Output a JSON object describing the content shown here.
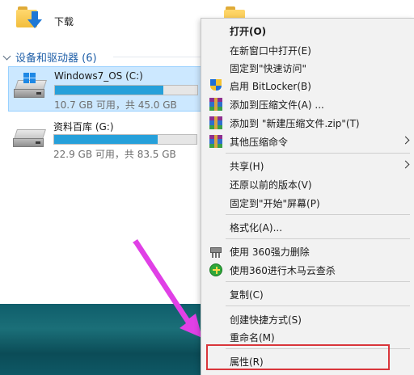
{
  "explorer": {
    "quick_item_label": "下载",
    "section_title": "设备和驱动器 (6)",
    "drives": [
      {
        "name": "Windows7_OS (C:)",
        "size_text": "10.7 GB 可用，共 45.0 GB",
        "used_fraction": 0.762
      },
      {
        "name": "资料百库 (G:)",
        "size_text": "22.9 GB 可用，共 83.5 GB",
        "used_fraction": 0.726
      }
    ]
  },
  "context_menu": {
    "items": [
      {
        "label": "打开(O)",
        "icon": ""
      },
      {
        "label": "在新窗口中打开(E)",
        "icon": ""
      },
      {
        "label": "固定到\"快速访问\"",
        "icon": ""
      },
      {
        "label": "启用 BitLocker(B)",
        "icon": "bitlocker-shield-icon"
      },
      {
        "label": "添加到压缩文件(A) ...",
        "icon": "winrar-icon"
      },
      {
        "label": "添加到 \"新建压缩文件.zip\"(T)",
        "icon": "winrar-icon"
      },
      {
        "label": "其他压缩命令",
        "icon": "winrar-icon"
      },
      {
        "label": "共享(H)",
        "icon": ""
      },
      {
        "label": "还原以前的版本(V)",
        "icon": ""
      },
      {
        "label": "固定到\"开始\"屏幕(P)",
        "icon": ""
      },
      {
        "label": "格式化(A)...",
        "icon": ""
      },
      {
        "label": "使用 360强力删除",
        "icon": "shredder-icon"
      },
      {
        "label": "使用360进行木马云查杀",
        "icon": "360-plus-icon"
      },
      {
        "label": "复制(C)",
        "icon": ""
      },
      {
        "label": "创建快捷方式(S)",
        "icon": ""
      },
      {
        "label": "重命名(M)",
        "icon": ""
      },
      {
        "label": "属性(R)",
        "icon": ""
      }
    ]
  },
  "colors": {
    "selection": "#cce8ff",
    "progress_fill": "#26a0da",
    "annotation_arrow": "#e040e6",
    "annotation_box": "#d9363b"
  }
}
